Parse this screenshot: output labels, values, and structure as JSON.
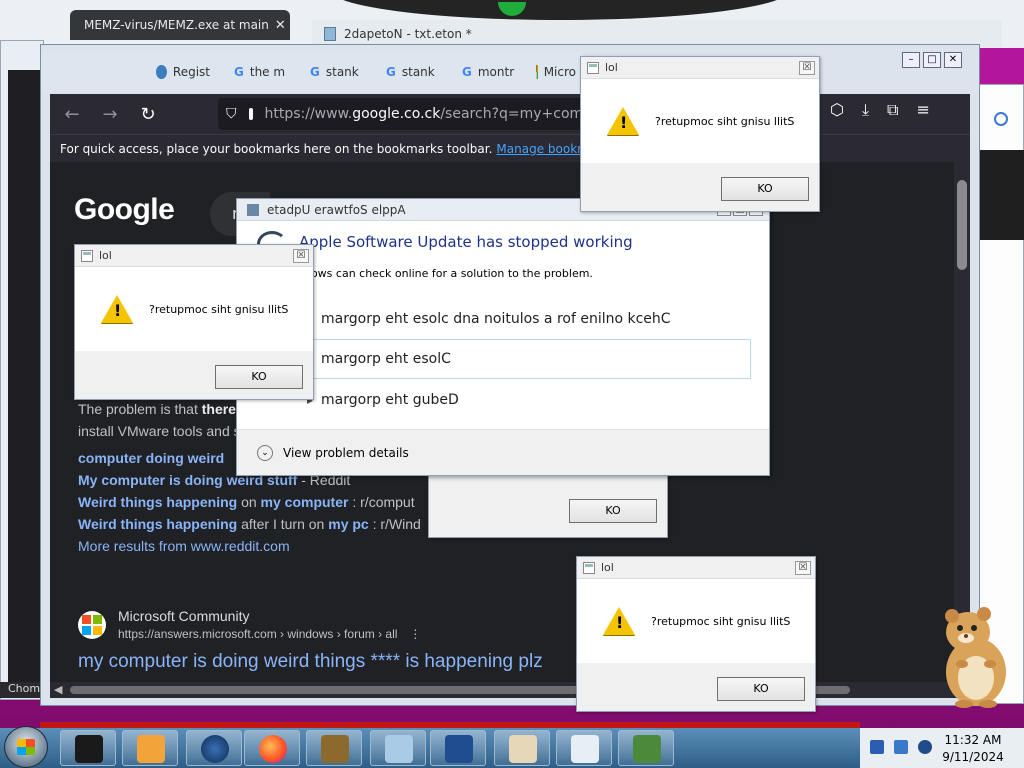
{
  "browser_tabs": [
    {
      "label": "MEMZ-virus/MEMZ.exe at main",
      "close": "✕"
    },
    {
      "label": "2dapetoN - txt.eton *"
    }
  ],
  "firefox": {
    "tabs": [
      "Regist",
      "the m",
      "stank",
      "stank",
      "montr",
      "Micro"
    ],
    "url_prefix": "https://www.",
    "url_domain": "google.co.ck",
    "url_rest": "/search?q=my+compute",
    "bookmarks_text": "For quick access, place your bookmarks here on the bookmarks toolbar.",
    "bookmarks_link": "Manage bookmarks...",
    "google_logo": "Google",
    "search_fragment": "m"
  },
  "results": {
    "snippet_line1_prefix": "The problem is that ",
    "snippet_line1_bold": "there",
    "snippet_line2": "install VMware tools and s",
    "links": [
      {
        "bold": "computer doing weird",
        "rest": ""
      },
      {
        "bold": "My computer is doing weird stuff",
        "rest": " - Reddit"
      },
      {
        "bold": "Weird things happening",
        "mid": " on ",
        "bold2": "my computer",
        "rest": " : r/comput"
      },
      {
        "bold": "Weird things happening",
        "mid": " after I turn on ",
        "bold2": "my pc",
        "rest": " : r/Wind"
      }
    ],
    "more_results": "More results from www.reddit.com",
    "ms_source": "Microsoft Community",
    "ms_url": "https://answers.microsoft.com › windows › forum › all",
    "ms_menu": "⋮",
    "ms_title": "my computer is doing weird things **** is happening plz"
  },
  "msgboxes": [
    {
      "title": "lol",
      "message": "?retupmoc siht gnisu llitS",
      "button": "KO",
      "close": "☒"
    },
    {
      "title": "lol",
      "message": "?retupmoc siht gnisu llitS",
      "button": "KO",
      "close": "☒"
    },
    {
      "title": "lol",
      "message": "?retupmoc siht gnisu llitS",
      "button": "KO",
      "close": "☒"
    },
    {
      "button": "KO"
    }
  ],
  "crash_dialog": {
    "title": "etadpU erawtfoS elppA",
    "heading": "Apple Software Update has stopped working",
    "subtext": "ndows can check online for a solution to the problem.",
    "options": [
      "margorp eht esolc dna noitulos a rof enilno kcehC",
      "margorp eht esolC",
      "margorp eht gubeD"
    ],
    "details": "View problem details",
    "details_glyph": "⌄"
  },
  "taskbar": {
    "time": "11:32 AM",
    "date": "9/11/2024"
  },
  "partial_label": "Chom",
  "icons": {
    "back": "←",
    "forward": "→",
    "reload": "↻",
    "shield": "⛉",
    "lock": "🔒",
    "pocket": "⬡",
    "download": "⤓",
    "extensions": "⧉",
    "menu": "≡",
    "warning": "!"
  }
}
